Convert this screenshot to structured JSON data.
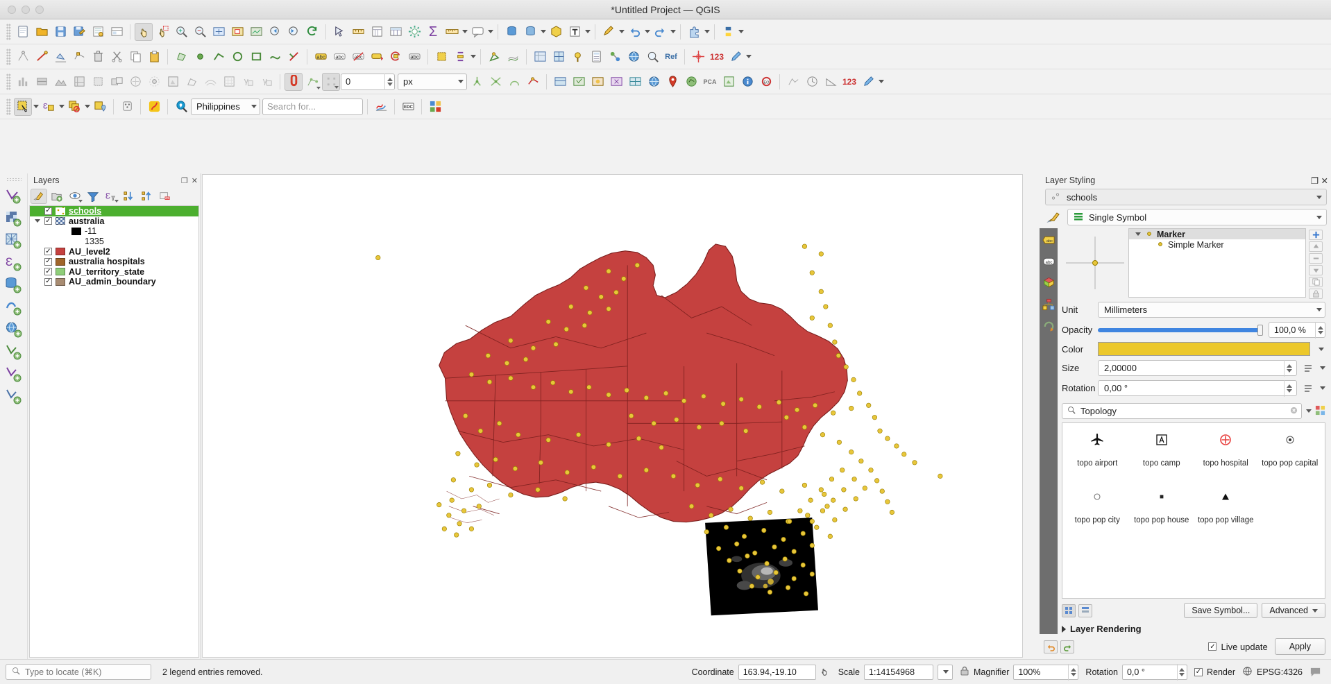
{
  "window": {
    "title": "*Untitled Project — QGIS"
  },
  "toolbar_row4": {
    "select_tool": "select-features",
    "location_combo": "Philippines",
    "search_placeholder": "Search for..."
  },
  "toolbar_row3": {
    "snapping_value": "0",
    "snapping_unit": "px"
  },
  "layers_panel": {
    "title": "Layers",
    "toolbar": [
      {
        "name": "open-layer-styling-panel",
        "label": "Open the Layer Styling panel"
      },
      {
        "name": "add-group",
        "label": "Add Group"
      },
      {
        "name": "manage-map-themes",
        "label": "Manage Map Themes"
      },
      {
        "name": "filter-legend",
        "label": "Filter Legend by Map Content"
      },
      {
        "name": "filter-legend-expression",
        "label": "Filter Legend by Expression"
      },
      {
        "name": "expand-all",
        "label": "Expand All"
      },
      {
        "name": "collapse-all",
        "label": "Collapse All"
      },
      {
        "name": "remove-layer",
        "label": "Remove Layer/Group"
      }
    ],
    "items": [
      {
        "label": "schools",
        "checked": true,
        "selected": true,
        "indent": 0,
        "symbol": "points",
        "color": "#ecc82b",
        "expander": false
      },
      {
        "label": "australia",
        "checked": true,
        "selected": false,
        "indent": 0,
        "symbol": "raster",
        "color": "#5b79a8",
        "expander": true
      },
      {
        "label": "-11",
        "checked": null,
        "selected": false,
        "indent": 1,
        "symbol": "fill",
        "color": "#000000",
        "expander": false
      },
      {
        "label": "1335",
        "checked": null,
        "selected": false,
        "indent": 1,
        "symbol": "none",
        "color": "#ffffff",
        "expander": false
      },
      {
        "label": "AU_level2",
        "checked": true,
        "selected": false,
        "indent": 0,
        "symbol": "fill",
        "color": "#c5413f",
        "expander": false
      },
      {
        "label": "australia hospitals",
        "checked": true,
        "selected": false,
        "indent": 0,
        "symbol": "fill",
        "color": "#a0652a",
        "expander": false
      },
      {
        "label": "AU_territory_state",
        "checked": true,
        "selected": false,
        "indent": 0,
        "symbol": "fill",
        "color": "#8fce7a",
        "expander": false
      },
      {
        "label": "AU_admin_boundary",
        "checked": true,
        "selected": false,
        "indent": 0,
        "symbol": "fill",
        "color": "#a88c72",
        "expander": false
      }
    ]
  },
  "styling_panel": {
    "title": "Layer Styling",
    "selected_layer": "schools",
    "renderer": "Single Symbol",
    "symbol_tree": [
      {
        "label": "Marker",
        "indent": 0,
        "bold": true,
        "highlighted": true
      },
      {
        "label": "Simple Marker",
        "indent": 1,
        "bold": false,
        "highlighted": false
      }
    ],
    "properties": {
      "unit_label": "Unit",
      "unit_value": "Millimeters",
      "opacity_label": "Opacity",
      "opacity_value": "100,0 %",
      "color_label": "Color",
      "color_value": "#ecc82b",
      "size_label": "Size",
      "size_value": "2,00000",
      "rotation_label": "Rotation",
      "rotation_value": "0,00 °"
    },
    "symbol_search": "Topology",
    "symbols": [
      {
        "label": "topo airport",
        "glyph": "airport"
      },
      {
        "label": "topo camp",
        "glyph": "camp"
      },
      {
        "label": "topo hospital",
        "glyph": "hospital"
      },
      {
        "label": "topo pop capital",
        "glyph": "capital"
      },
      {
        "label": "topo pop city",
        "glyph": "city"
      },
      {
        "label": "topo pop house",
        "glyph": "house"
      },
      {
        "label": "topo pop village",
        "glyph": "village"
      }
    ],
    "save_symbol_label": "Save Symbol...",
    "advanced_label": "Advanced",
    "layer_rendering_label": "Layer Rendering",
    "live_update_label": "Live update",
    "apply_label": "Apply"
  },
  "statusbar": {
    "locate_placeholder": "Type to locate (⌘K)",
    "message": "2 legend entries removed.",
    "coordinate_label": "Coordinate",
    "coordinate_value": "163.94,-19.10",
    "scale_label": "Scale",
    "scale_value": "1:14154968",
    "magnifier_label": "Magnifier",
    "magnifier_value": "100%",
    "rotation_label": "Rotation",
    "rotation_value": "0,0 °",
    "render_label": "Render",
    "crs_label": "EPSG:4326"
  }
}
